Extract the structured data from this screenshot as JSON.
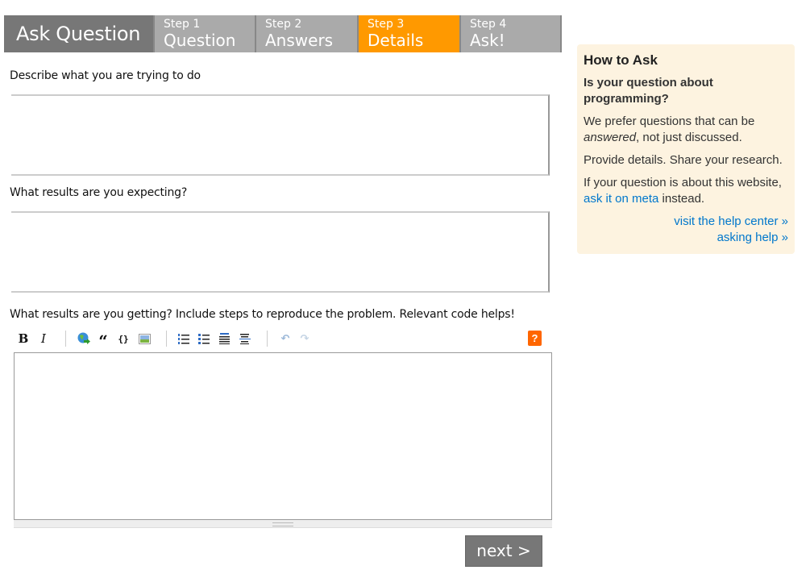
{
  "tabs": {
    "title": "Ask Question",
    "steps": [
      {
        "step": "Step 1",
        "name": "Question",
        "active": false
      },
      {
        "step": "Step 2",
        "name": "Answers",
        "active": false
      },
      {
        "step": "Step 3",
        "name": "Details",
        "active": true
      },
      {
        "step": "Step 4",
        "name": "Ask!",
        "active": false
      }
    ],
    "active_color": "#ff9900",
    "inactive_color": "#aaaaaa"
  },
  "form": {
    "describe_label": "Describe what you are trying to do",
    "describe_value": "",
    "expecting_label": "What results are you expecting?",
    "expecting_value": "",
    "getting_label": "What results are you getting? Include steps to reproduce the problem.  Relevant code helps!",
    "getting_value": ""
  },
  "toolbar": {
    "buttons": [
      {
        "icon": "bold-icon",
        "glyph": "B"
      },
      {
        "icon": "italic-icon",
        "glyph": "I"
      },
      {
        "icon": "link-icon",
        "glyph": "globe"
      },
      {
        "icon": "blockquote-icon",
        "glyph": "“"
      },
      {
        "icon": "code-icon",
        "glyph": "{ }"
      },
      {
        "icon": "image-icon",
        "glyph": "img"
      },
      {
        "icon": "numbered-list-icon",
        "glyph": "ol"
      },
      {
        "icon": "bulleted-list-icon",
        "glyph": "ul"
      },
      {
        "icon": "heading-icon",
        "glyph": "h"
      },
      {
        "icon": "horizontal-rule-icon",
        "glyph": "hr"
      },
      {
        "icon": "undo-icon",
        "glyph": "↶"
      },
      {
        "icon": "redo-icon",
        "glyph": "↷"
      }
    ],
    "help_glyph": "?"
  },
  "next_button": "next >",
  "sidebar": {
    "title": "How to Ask",
    "subtitle": "Is your question about programming?",
    "p1_before": "We prefer questions that can be ",
    "p1_em": "answered",
    "p1_after": ", not just discussed.",
    "p2": "Provide details. Share your research.",
    "p3_before": "If your question is about this website, ",
    "p3_link": "ask it on meta",
    "p3_after": " instead.",
    "link_help_center": "visit the help center »",
    "link_asking_help": "asking help »"
  }
}
